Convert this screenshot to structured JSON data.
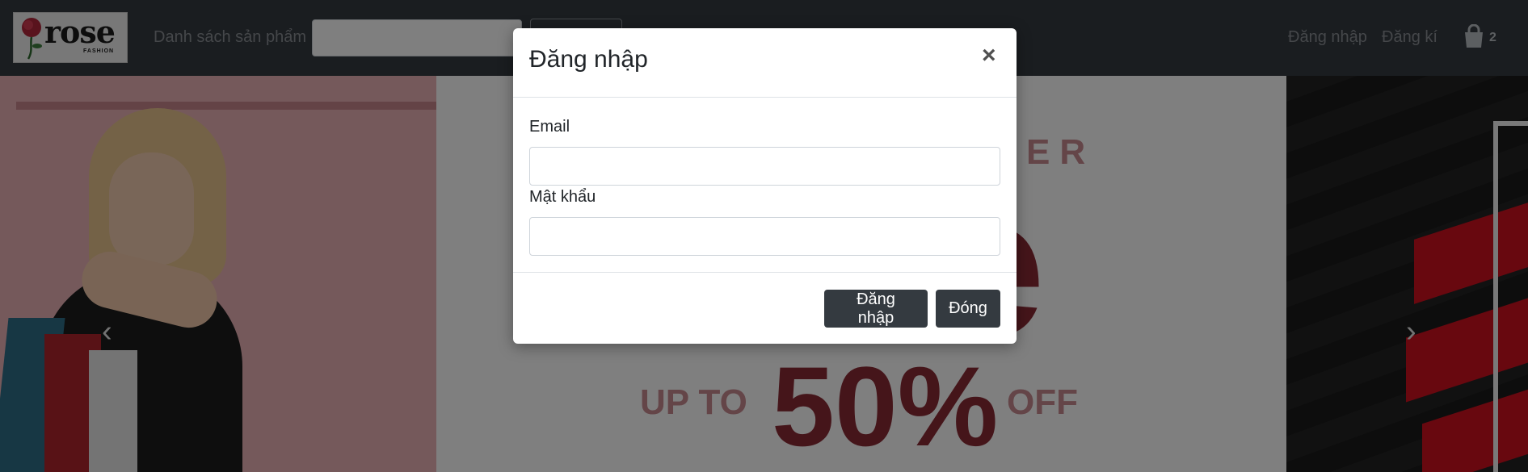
{
  "navbar": {
    "brand": {
      "word": "rose",
      "sub": "FASHION"
    },
    "products_link": "Danh sách sản phẩm",
    "search": {
      "placeholder": "",
      "button_label": ""
    },
    "login_link": "Đăng nhập",
    "register_link": "Đăng kí",
    "cart": {
      "icon": "shopping-bag-icon",
      "count": "2"
    }
  },
  "carousel": {
    "slide1": {
      "top_text": "ER",
      "big_text": "e",
      "upto": "UP TO",
      "percent": "50%",
      "off": "OFF"
    },
    "prev_icon": "chevron-left-icon",
    "next_icon": "chevron-right-icon"
  },
  "modal": {
    "title": "Đăng nhập",
    "close_symbol": "×",
    "email_label": "Email",
    "email_value": "",
    "password_label": "Mật khẩu",
    "password_value": "",
    "login_button": "Đăng nhập",
    "close_button": "Đóng"
  },
  "colors": {
    "navbar": "#343a40",
    "button_dark": "#343a40",
    "promo_dark": "#8a2a35",
    "promo_light": "#c98a91",
    "slide_pink": "#eab2b6",
    "accent_red": "#d1101f"
  }
}
